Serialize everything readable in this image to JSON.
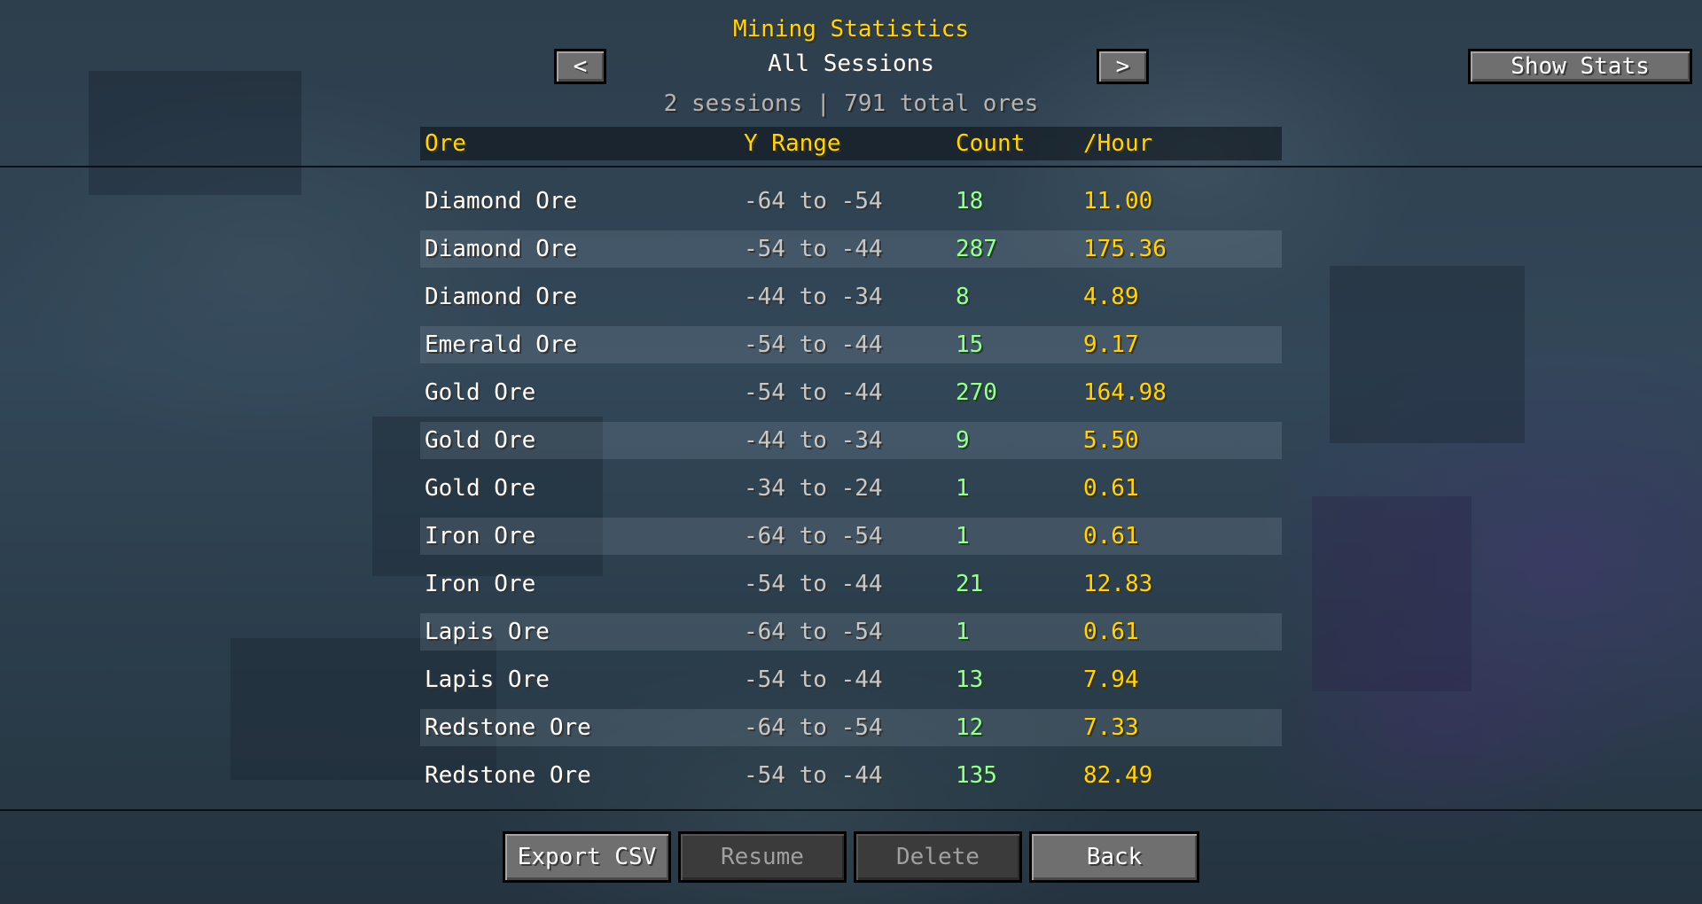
{
  "header": {
    "title": "Mining Statistics",
    "subtitle": "All Sessions",
    "prev_label": "<",
    "next_label": ">",
    "show_stats_label": "Show Stats",
    "summary": "2 sessions  |  791 total ores"
  },
  "table": {
    "columns": [
      "Ore",
      "Y Range",
      "Count",
      "/Hour"
    ],
    "rows": [
      {
        "ore": "Diamond Ore",
        "y_range": "-64 to -54",
        "count": "18",
        "per_hour": "11.00"
      },
      {
        "ore": "Diamond Ore",
        "y_range": "-54 to -44",
        "count": "287",
        "per_hour": "175.36"
      },
      {
        "ore": "Diamond Ore",
        "y_range": "-44 to -34",
        "count": "8",
        "per_hour": "4.89"
      },
      {
        "ore": "Emerald Ore",
        "y_range": "-54 to -44",
        "count": "15",
        "per_hour": "9.17"
      },
      {
        "ore": "Gold Ore",
        "y_range": "-54 to -44",
        "count": "270",
        "per_hour": "164.98"
      },
      {
        "ore": "Gold Ore",
        "y_range": "-44 to -34",
        "count": "9",
        "per_hour": "5.50"
      },
      {
        "ore": "Gold Ore",
        "y_range": "-34 to -24",
        "count": "1",
        "per_hour": "0.61"
      },
      {
        "ore": "Iron Ore",
        "y_range": "-64 to -54",
        "count": "1",
        "per_hour": "0.61"
      },
      {
        "ore": "Iron Ore",
        "y_range": "-54 to -44",
        "count": "21",
        "per_hour": "12.83"
      },
      {
        "ore": "Lapis Ore",
        "y_range": "-64 to -54",
        "count": "1",
        "per_hour": "0.61"
      },
      {
        "ore": "Lapis Ore",
        "y_range": "-54 to -44",
        "count": "13",
        "per_hour": "7.94"
      },
      {
        "ore": "Redstone Ore",
        "y_range": "-64 to -54",
        "count": "12",
        "per_hour": "7.33"
      },
      {
        "ore": "Redstone Ore",
        "y_range": "-54 to -44",
        "count": "135",
        "per_hour": "82.49"
      }
    ]
  },
  "footer": {
    "export_label": "Export CSV",
    "resume_label": "Resume",
    "delete_label": "Delete",
    "back_label": "Back"
  },
  "colors": {
    "title": "#ffd21a",
    "count": "#9aff9a",
    "per_hour": "#ffd21a",
    "button": "#6f6f6f",
    "button_disabled": "#3b3b3b"
  }
}
